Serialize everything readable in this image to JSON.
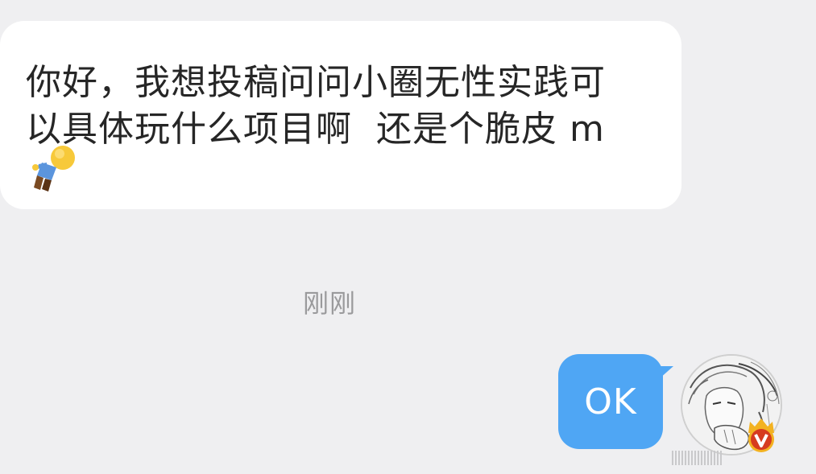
{
  "conversation": {
    "incoming": {
      "line1": "你好，我想投稿问问小圈无性实践可",
      "line2": "以具体玩什么项目啊  还是个脆皮 m",
      "emoji": "person-lying-down-emoji"
    },
    "timestamp": "刚刚",
    "outgoing": {
      "text": "OK"
    }
  },
  "avatar": {
    "badge": "verified-v-badge",
    "badge_color": "#d63b1f"
  },
  "colors": {
    "background": "#efeff1",
    "incoming_bubble": "#ffffff",
    "outgoing_bubble": "#4fa6f4",
    "timestamp": "#9a9a9c"
  }
}
